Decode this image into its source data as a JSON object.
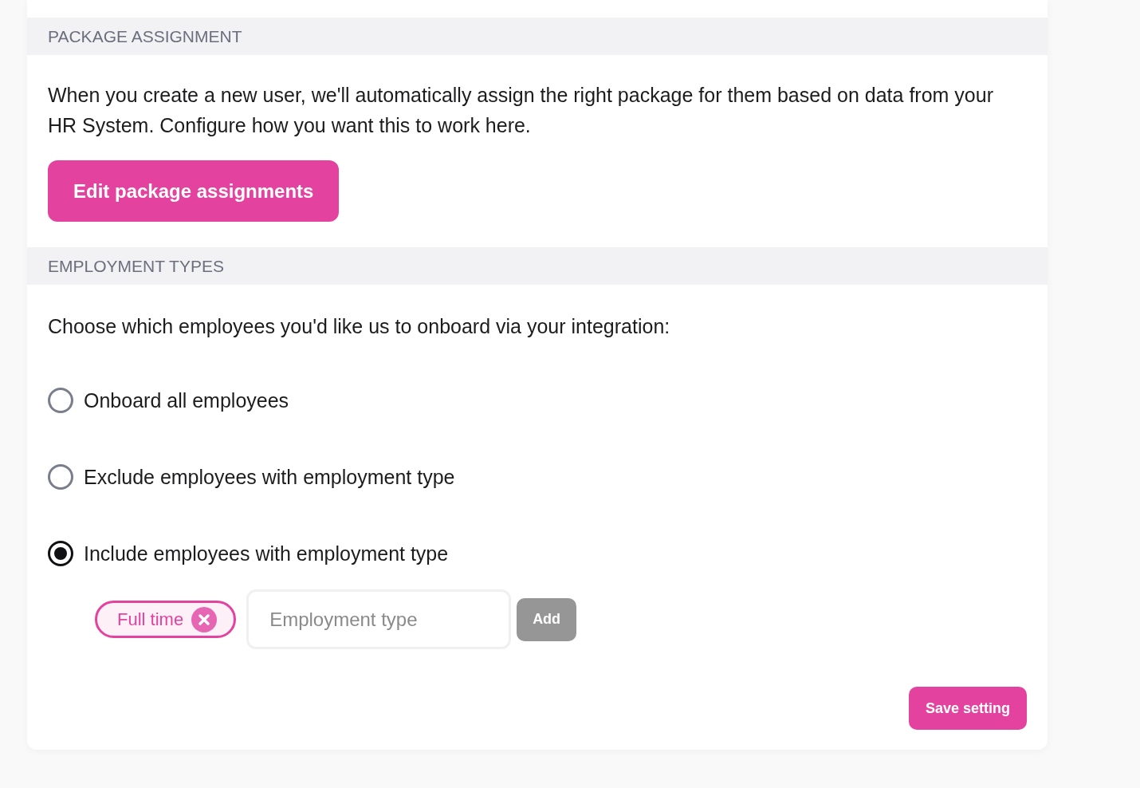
{
  "package_assignment": {
    "header": "PACKAGE ASSIGNMENT",
    "description": "When you create a new user, we'll automatically assign the right package for them based on data from your HR System. Configure how you want this to work here.",
    "button": "Edit package assignments"
  },
  "employment_types": {
    "header": "EMPLOYMENT TYPES",
    "prompt": "Choose which employees you'd like us to onboard via your integration:",
    "options": [
      {
        "label": "Onboard all employees",
        "selected": false
      },
      {
        "label": "Exclude employees with employment type",
        "selected": false
      },
      {
        "label": "Include employees with employment type",
        "selected": true
      }
    ],
    "tags": [
      {
        "label": "Full time"
      }
    ],
    "input": {
      "placeholder": "Employment type"
    },
    "add_button": {
      "label": "Add",
      "disabled": true
    },
    "save_button": "Save setting"
  }
}
